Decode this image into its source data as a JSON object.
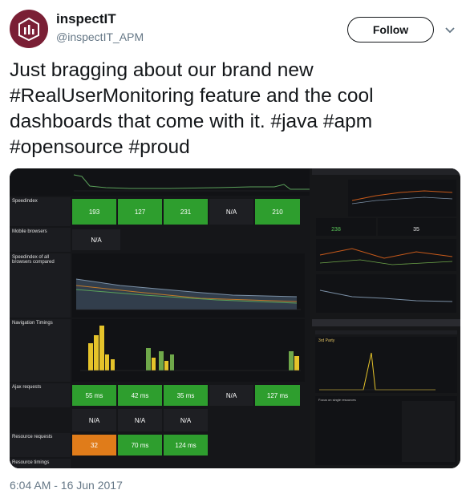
{
  "account": {
    "display_name": "inspectIT",
    "handle": "@inspectIT_APM",
    "avatar_icon": "inspectit-logo-icon",
    "avatar_color": "#7a1f35"
  },
  "follow_label": "Follow",
  "tweet": {
    "lines": [
      "Just bragging about our brand new",
      "#RealUserMonitoring feature and the cool",
      "dashboards that come with it. #java #apm",
      "#opensource #proud"
    ]
  },
  "timestamp": "6:04 AM - 16 Jun 2017",
  "dashboard": {
    "speedindex": {
      "title": "Speedindex",
      "values": [
        "193",
        "127",
        "231",
        "N/A",
        "210"
      ]
    },
    "mobile": {
      "title": "Mobile browsers",
      "value": "N/A"
    },
    "compare": {
      "title": "Speedindex of all browsers compared"
    },
    "nav": {
      "title": "Navigation Timings"
    },
    "ajax": {
      "title": "Ajax requests",
      "values": [
        "55 ms",
        "42 ms",
        "35 ms",
        "N/A",
        "127 ms"
      ],
      "na_values": [
        "N/A",
        "N/A",
        "N/A"
      ]
    },
    "resource": {
      "title": "Resource requests",
      "values": [
        "32",
        "70 ms",
        "124 ms"
      ]
    },
    "resource_timings": {
      "title": "Resource timings"
    },
    "right_top": {
      "stat1": "238",
      "stat2": "35"
    },
    "right_bottom": {
      "title1": "3rd Party",
      "title2": "Focus on single resources"
    }
  },
  "colors": {
    "green": "#2e9e2e",
    "orange": "#e07c1a",
    "yellow_bar": "#e5c32a",
    "green_bar": "#6fa84a"
  }
}
